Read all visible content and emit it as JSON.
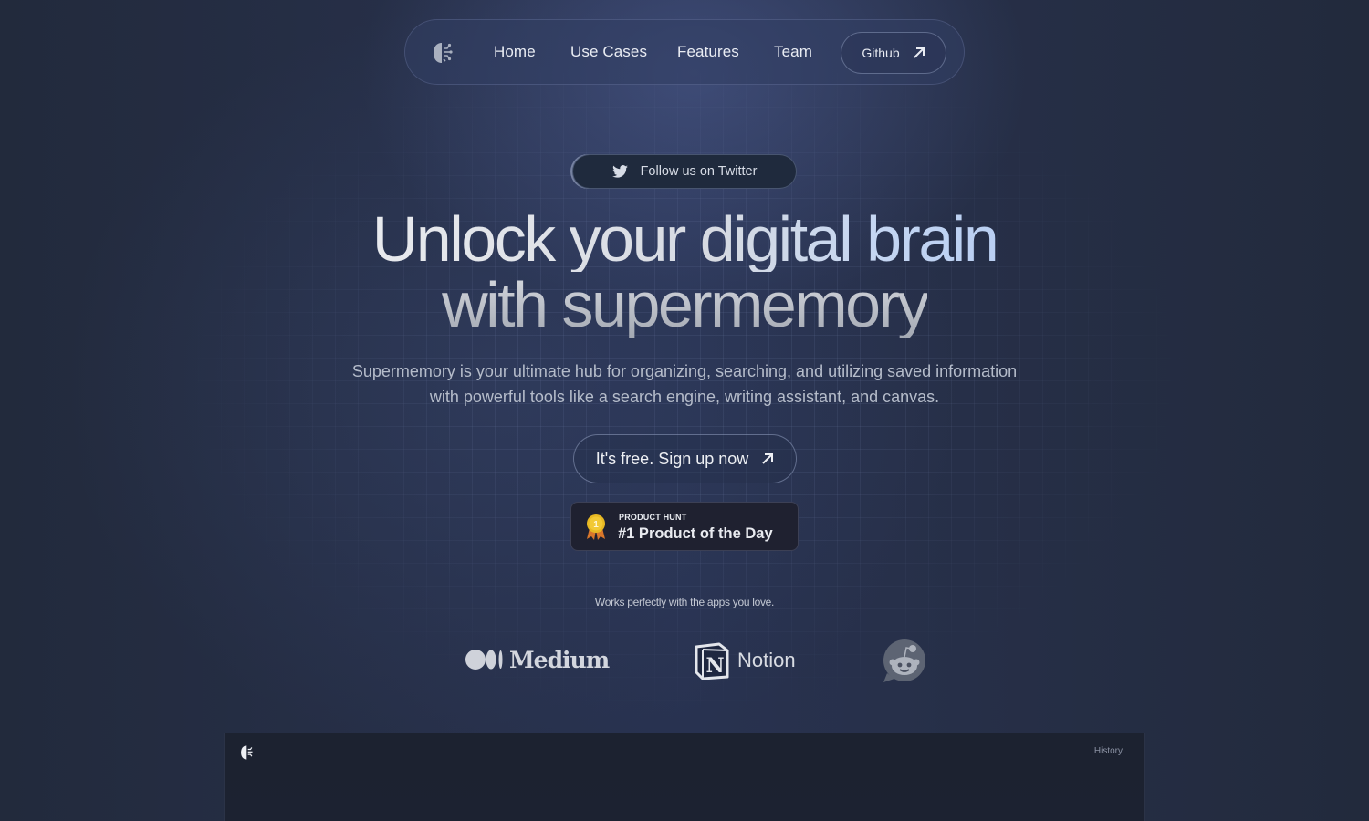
{
  "navbar": {
    "logo": "supermemory-brain-logo",
    "links": [
      {
        "label": "Home"
      },
      {
        "label": "Use Cases"
      },
      {
        "label": "Features"
      },
      {
        "label": "Team"
      }
    ],
    "github": {
      "label": "Github",
      "icon": "arrow-up-right-icon"
    }
  },
  "twitter_pill": {
    "label": "Follow us on Twitter",
    "icon": "twitter-bird-icon"
  },
  "hero": {
    "title_line1": "Unlock your digital brain",
    "title_line2": "with supermemory",
    "subtitle_line1": "Supermemory is your ultimate hub for organizing, searching, and utilizing saved information",
    "subtitle_line2": "with powerful tools like a search engine, writing assistant, and canvas."
  },
  "cta": {
    "label": "It's free. Sign up now",
    "icon": "arrow-up-right-icon"
  },
  "product_hunt": {
    "kicker": "PRODUCT HUNT",
    "title": "#1 Product of the Day",
    "medal_number": "1"
  },
  "integrations": {
    "caption": "Works perfectly with the apps you love.",
    "apps": [
      {
        "name": "Medium"
      },
      {
        "name": "Notion"
      },
      {
        "name": "Reddit"
      }
    ]
  },
  "preview": {
    "history_label": "History"
  },
  "colors": {
    "background": "#262f47",
    "accent_text": "#c5d6f2",
    "badge_bg": "#1f2130",
    "medal_gold": "#e8b923",
    "medal_ribbon": "#d9772b"
  }
}
